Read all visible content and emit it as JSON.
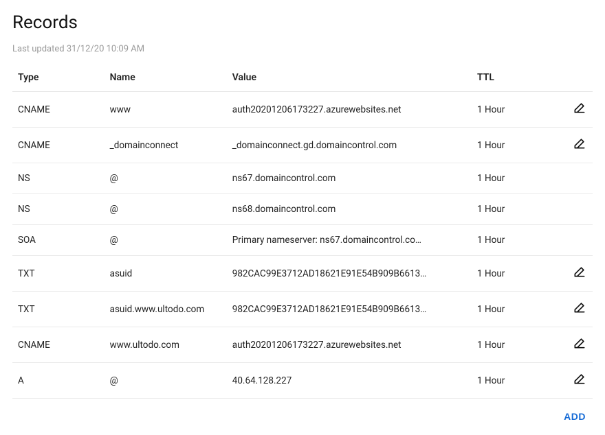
{
  "header": {
    "title": "Records",
    "last_updated": "Last updated 31/12/20 10:09 AM"
  },
  "table": {
    "columns": {
      "type": "Type",
      "name": "Name",
      "value": "Value",
      "ttl": "TTL"
    },
    "rows": [
      {
        "type": "CNAME",
        "name": "www",
        "value": "auth20201206173227.azurewebsites.net",
        "ttl": "1 Hour",
        "editable": true
      },
      {
        "type": "CNAME",
        "name": "_domainconnect",
        "value": "_domainconnect.gd.domaincontrol.com",
        "ttl": "1 Hour",
        "editable": true
      },
      {
        "type": "NS",
        "name": "@",
        "value": "ns67.domaincontrol.com",
        "ttl": "1 Hour",
        "editable": false
      },
      {
        "type": "NS",
        "name": "@",
        "value": "ns68.domaincontrol.com",
        "ttl": "1 Hour",
        "editable": false
      },
      {
        "type": "SOA",
        "name": "@",
        "value": "Primary nameserver: ns67.domaincontrol.co…",
        "ttl": "1 Hour",
        "editable": false
      },
      {
        "type": "TXT",
        "name": "asuid",
        "value": "982CAC99E3712AD18621E91E54B909B6613…",
        "ttl": "1 Hour",
        "editable": true
      },
      {
        "type": "TXT",
        "name": "asuid.www.ultodo.com",
        "value": "982CAC99E3712AD18621E91E54B909B6613…",
        "ttl": "1 Hour",
        "editable": true
      },
      {
        "type": "CNAME",
        "name": "www.ultodo.com",
        "value": "auth20201206173227.azurewebsites.net",
        "ttl": "1 Hour",
        "editable": true
      },
      {
        "type": "A",
        "name": "@",
        "value": "40.64.128.227",
        "ttl": "1 Hour",
        "editable": true
      }
    ]
  },
  "footer": {
    "add_label": "ADD"
  }
}
